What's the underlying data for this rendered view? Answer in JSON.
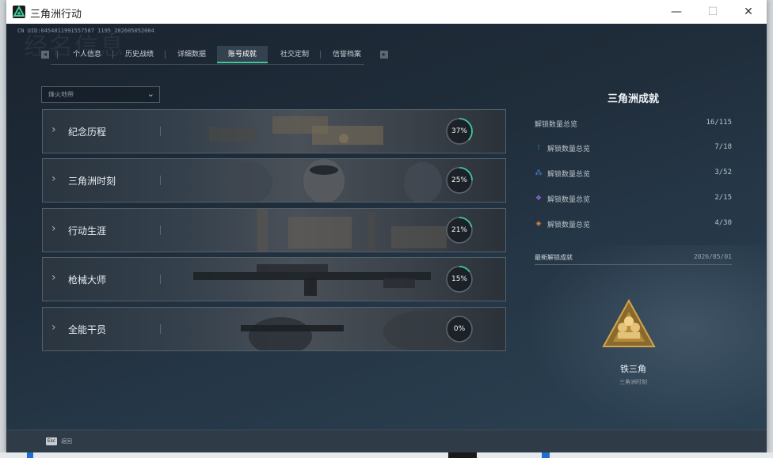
{
  "window": {
    "title": "三角洲行动",
    "controls": {
      "minimize": "—",
      "maximize": "☐",
      "close": "✕"
    }
  },
  "header": {
    "uid": "CN UID:0454011991557587 1195_202605052004",
    "watermark": "经名信息"
  },
  "tabs": {
    "prev_icon": "◂",
    "next_icon": "▸",
    "items": [
      {
        "label": "个人信息",
        "active": false
      },
      {
        "label": "历史战绩",
        "active": false
      },
      {
        "label": "详细数据",
        "active": false
      },
      {
        "label": "账号成就",
        "active": true
      },
      {
        "label": "社交定制",
        "active": false
      },
      {
        "label": "信誉档案",
        "active": false
      }
    ]
  },
  "filter": {
    "value": "烽火地带",
    "icon": "chevron-down-icon"
  },
  "achievements": [
    {
      "name": "纪念历程",
      "percent": 37,
      "percent_label": "37%"
    },
    {
      "name": "三角洲时刻",
      "percent": 25,
      "percent_label": "25%"
    },
    {
      "name": "行动生涯",
      "percent": 21,
      "percent_label": "21%"
    },
    {
      "name": "枪械大师",
      "percent": 15,
      "percent_label": "15%"
    },
    {
      "name": "全能干员",
      "percent": 0,
      "percent_label": "0%"
    }
  ],
  "summary": {
    "title": "三角洲成就",
    "total": {
      "label": "解锁数量总览",
      "value": "16/115"
    },
    "rows": [
      {
        "label": "解锁数量总览",
        "value": "7/18",
        "icon": "green-gem-icon",
        "color": "#2fbf8f"
      },
      {
        "label": "解锁数量总览",
        "value": "3/52",
        "icon": "blue-gem-icon",
        "color": "#4a8fe0"
      },
      {
        "label": "解锁数量总览",
        "value": "2/15",
        "icon": "purple-gem-icon",
        "color": "#9a6ad8"
      },
      {
        "label": "解锁数量总览",
        "value": "4/30",
        "icon": "orange-gem-icon",
        "color": "#e08a3a"
      }
    ]
  },
  "latest": {
    "heading": "最新解锁成就",
    "date": "2026/05/01",
    "badge_name": "铁三角",
    "badge_category": "三角洲时刻"
  },
  "footer": {
    "esc_key": "Esc",
    "esc_label": "返回"
  },
  "colors": {
    "accent": "#42c79a",
    "badge_gold": "#b58a3a"
  }
}
